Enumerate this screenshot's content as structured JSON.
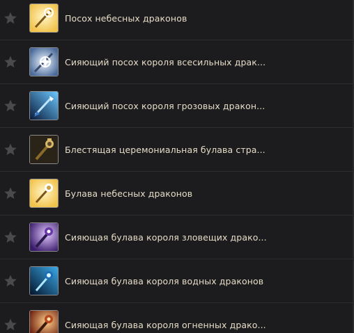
{
  "items": [
    {
      "name": "Посох небесных драконов",
      "icon": "staff-heavenly-dragons-icon",
      "bg": "#f2c24a",
      "fg": "#fff6c8"
    },
    {
      "name": "Сияющий посох короля всесильных драк...",
      "icon": "staff-almighty-dragon-king-icon",
      "bg": "#8fb4d6",
      "fg": "#eef6ff"
    },
    {
      "name": "Сияющий посох короля грозовых дракон...",
      "icon": "staff-storm-dragon-king-icon",
      "bg": "#3a78c8",
      "fg": "#bfe6ff"
    },
    {
      "name": "Блестящая церемониальная булава стра...",
      "icon": "ceremonial-mace-icon",
      "bg": "#5a4a2a",
      "fg": "#d9b86a"
    },
    {
      "name": "Булава небесных драконов",
      "icon": "mace-heavenly-dragons-icon",
      "bg": "#f2c24a",
      "fg": "#fff6c8"
    },
    {
      "name": "Сияющая булава короля зловещих драко...",
      "icon": "mace-sinister-dragon-king-icon",
      "bg": "#6a3aa8",
      "fg": "#e0c8ff"
    },
    {
      "name": "Сияющая булава короля водных драконов",
      "icon": "mace-water-dragon-king-icon",
      "bg": "#1e6fb8",
      "fg": "#aee8ff"
    },
    {
      "name": "Сияющая булава короля огненных драко...",
      "icon": "mace-fire-dragon-king-icon",
      "bg": "#b8481e",
      "fg": "#ffcf8a"
    }
  ]
}
